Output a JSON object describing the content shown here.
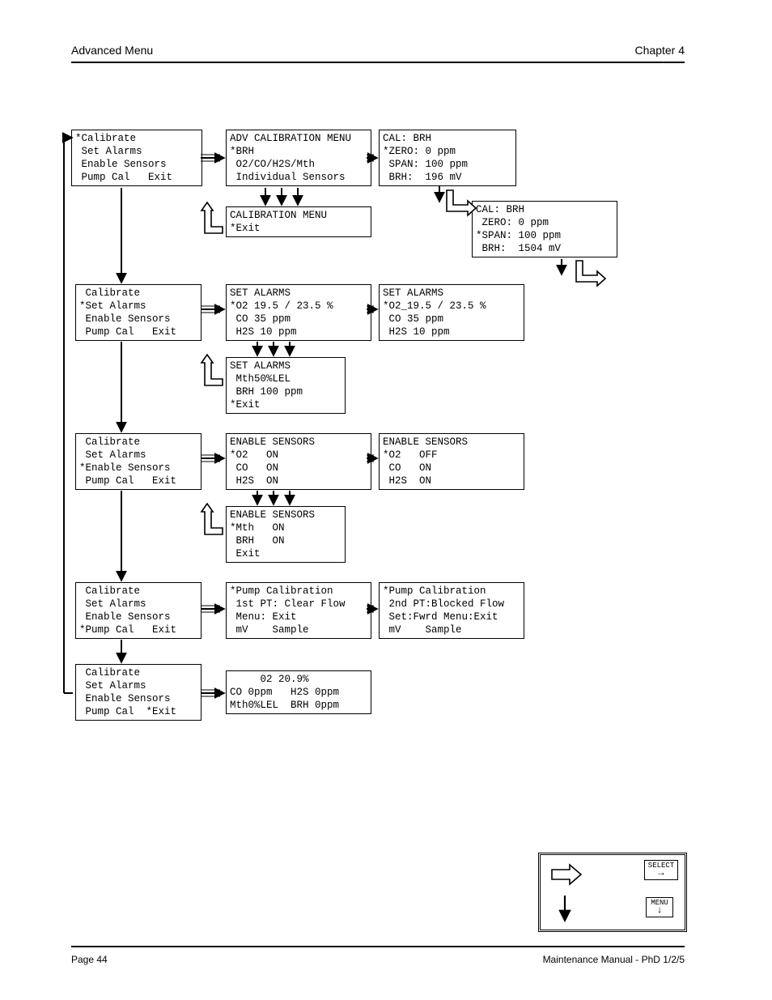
{
  "header": {
    "left": "Advanced Menu",
    "right": "Chapter 4"
  },
  "footer": {
    "left": "Page 44",
    "right": "Maintenance Manual - PhD 1/2/5"
  },
  "rows": {
    "r1": {
      "a": "*Calibrate\n Set Alarms\n Enable Sensors\n Pump Cal   Exit",
      "b": "ADV CALIBRATION MENU\n*BRH\n O2/CO/H2S/Mth\n Individual Sensors",
      "c": "CAL: BRH\n*ZERO: 0 ppm\n SPAN: 100 ppm\n BRH:  196 mV",
      "sub": "CALIBRATION MENU\n*Exit",
      "d": "CAL: BRH\n ZERO: 0 ppm\n*SPAN: 100 ppm\n BRH:  1504 mV"
    },
    "r2": {
      "a": " Calibrate\n*Set Alarms\n Enable Sensors\n Pump Cal   Exit",
      "b": "SET ALARMS\n*O2 19.5 / 23.5 %\n CO 35 ppm\n H2S 10 ppm",
      "c": "SET ALARMS\n*O2_19.5 / 23.5 %\n CO 35 ppm\n H2S 10 ppm",
      "sub": "SET ALARMS\n Mth50%LEL\n BRH 100 ppm\n*Exit"
    },
    "r3": {
      "a": " Calibrate\n Set Alarms\n*Enable Sensors\n Pump Cal   Exit",
      "b": "ENABLE SENSORS\n*O2   ON\n CO   ON\n H2S  ON",
      "c": "ENABLE SENSORS\n*O2   OFF\n CO   ON\n H2S  ON",
      "sub": "ENABLE SENSORS\n*Mth   ON\n BRH   ON\n Exit"
    },
    "r4": {
      "a": " Calibrate\n Set Alarms\n Enable Sensors\n*Pump Cal   Exit",
      "b": "*Pump Calibration\n 1st PT: Clear Flow\n Menu: Exit\n mV    Sample",
      "c": "*Pump Calibration\n 2nd PT:Blocked Flow\n Set:Fwrd Menu:Exit\n mV    Sample"
    },
    "r5": {
      "a": " Calibrate\n Set Alarms\n Enable Sensors\n Pump Cal  *Exit",
      "b": "     02 20.9%\nCO 0ppm   H2S 0ppm\nMth0%LEL  BRH 0ppm"
    }
  },
  "legend": {
    "select": "SELECT",
    "menu": "MENU"
  }
}
